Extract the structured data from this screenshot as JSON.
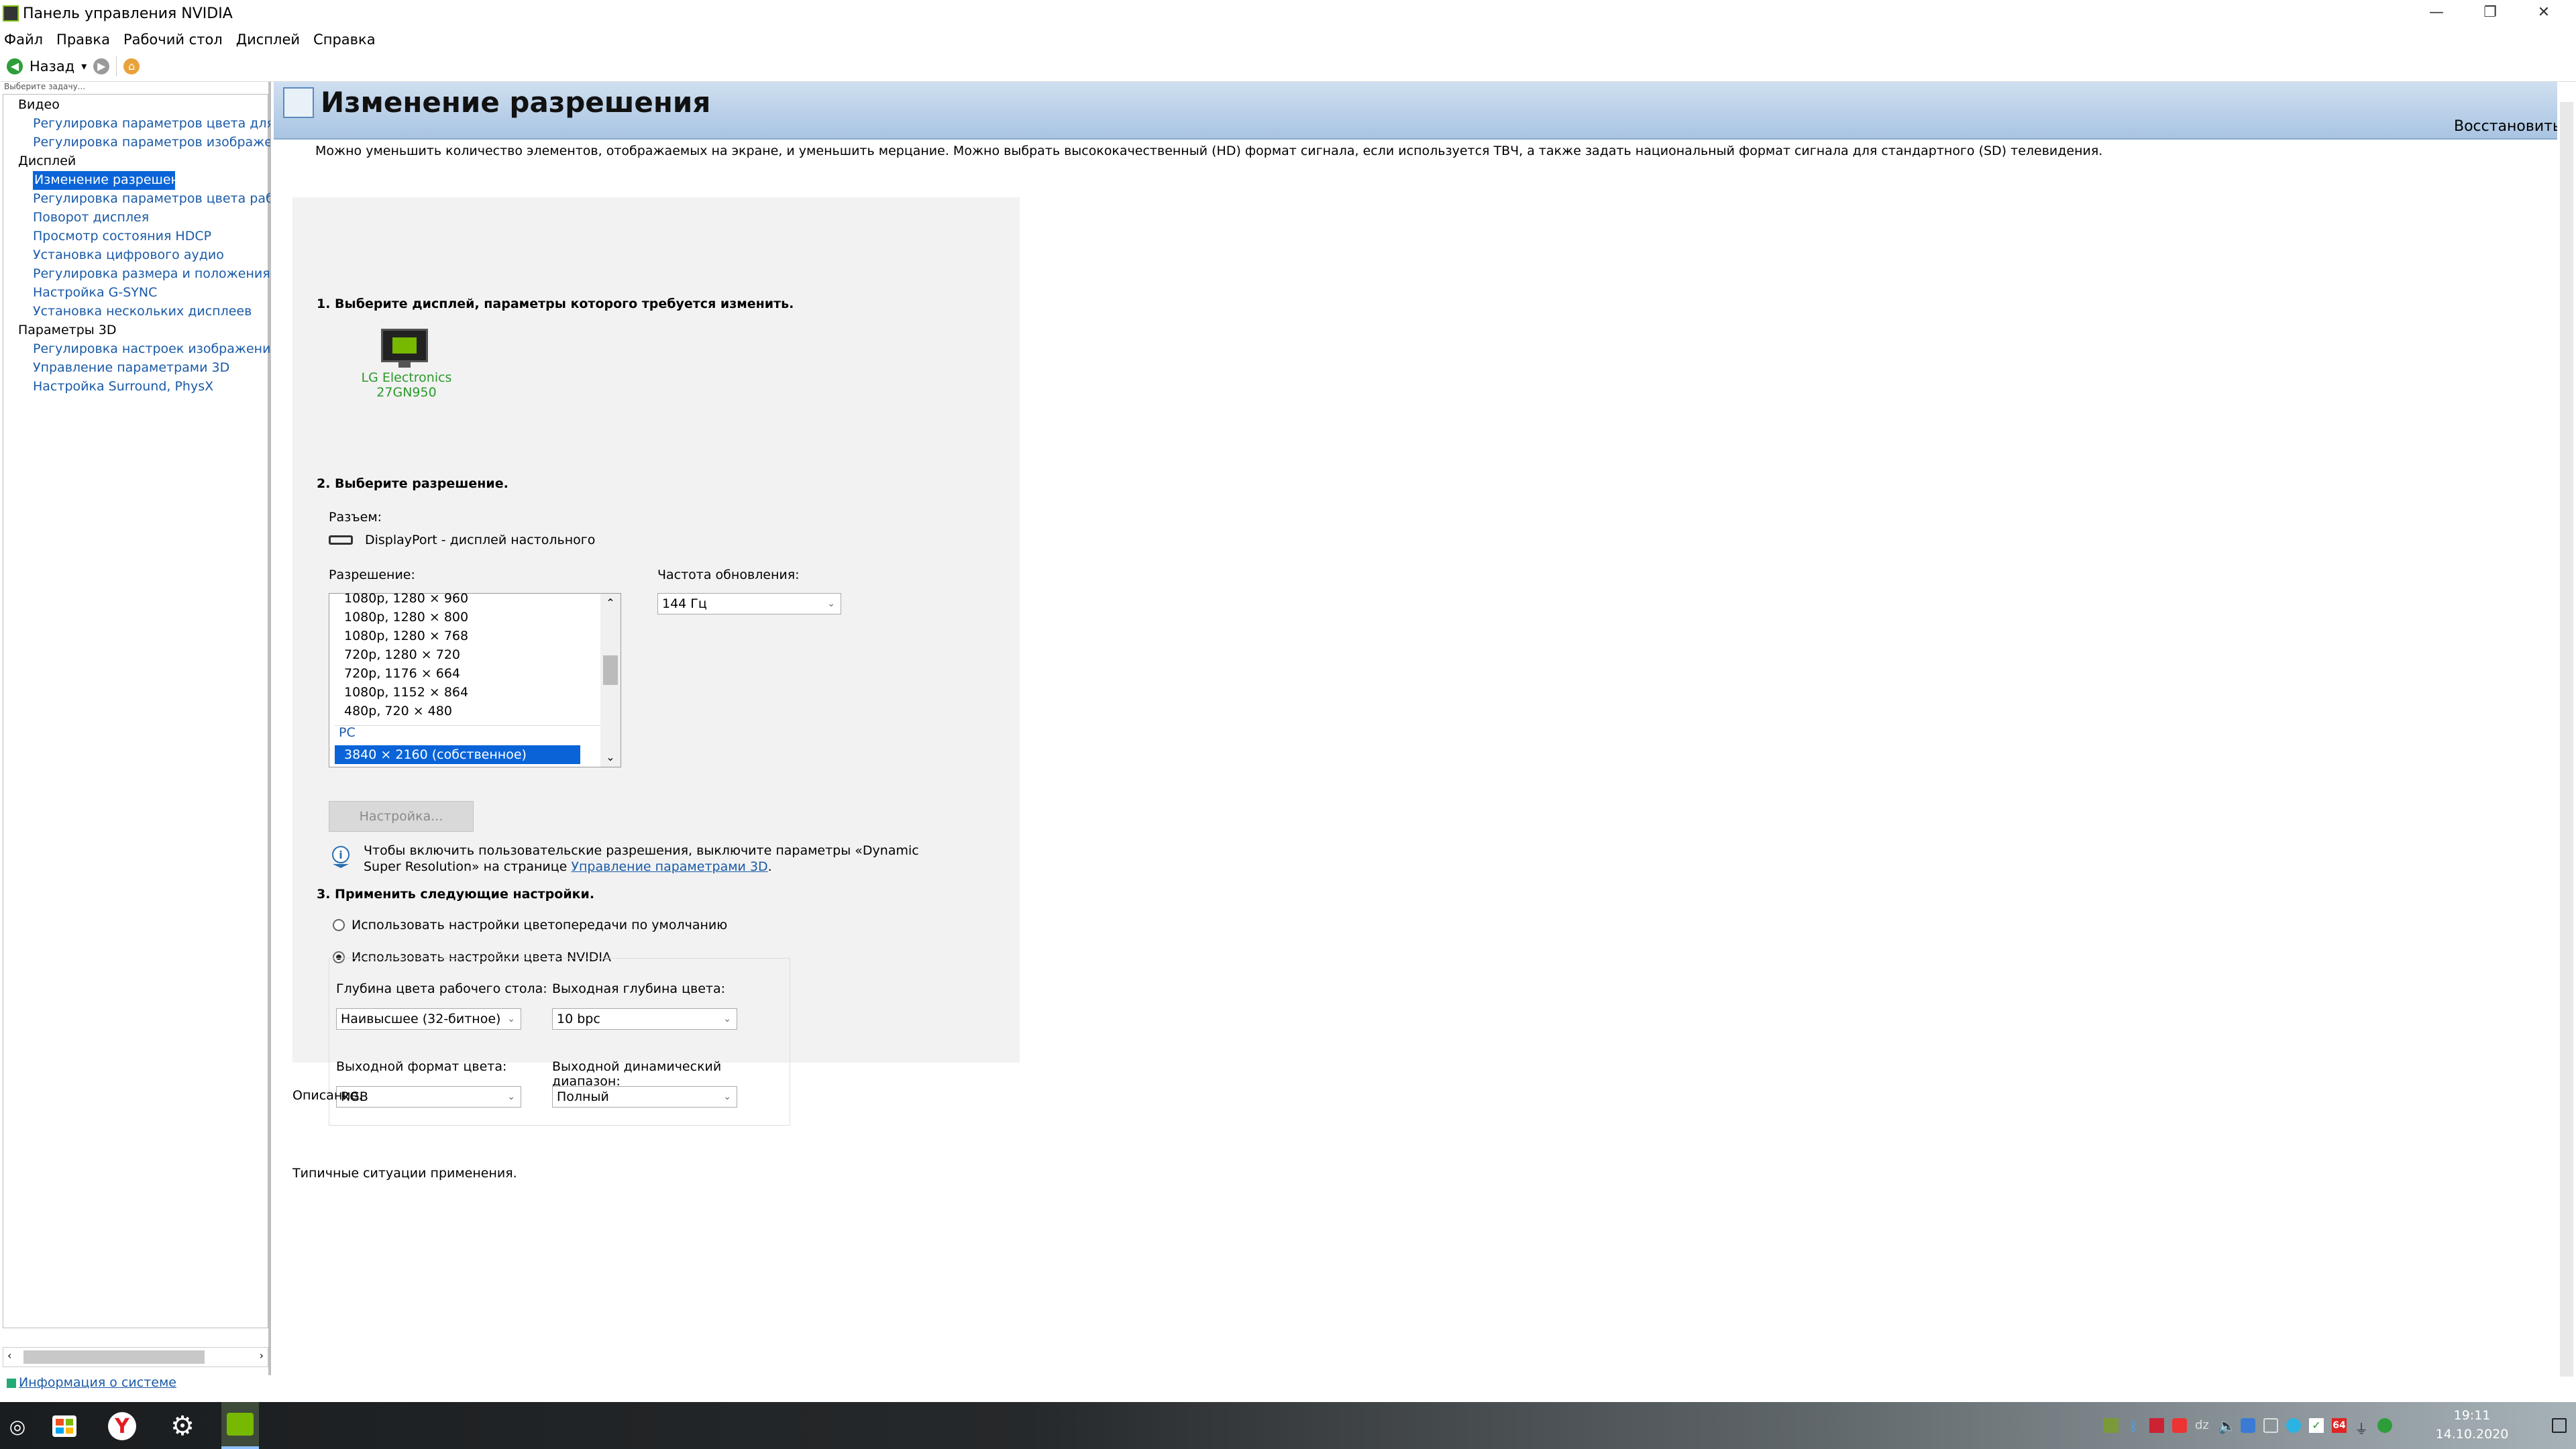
{
  "window": {
    "title": "Панель управления NVIDIA",
    "minimize": "—",
    "maximize": "❐",
    "close": "✕"
  },
  "menu": [
    "Файл",
    "Правка",
    "Рабочий стол",
    "Дисплей",
    "Справка"
  ],
  "toolbar": {
    "back_label": "Назад",
    "dropdown_glyph": "▾"
  },
  "sidebar": {
    "hint": "Выберите задачу...",
    "categories": [
      {
        "label": "Видео",
        "items": [
          "Регулировка параметров цвета для видео",
          "Регулировка параметров изображения для видео"
        ]
      },
      {
        "label": "Дисплей",
        "items": [
          "Изменение разрешения",
          "Регулировка параметров цвета рабочего стола",
          "Поворот дисплея",
          "Просмотр состояния HDCP",
          "Установка цифрового аудио",
          "Регулировка размера и положения рабочего стола",
          "Настройка G-SYNC",
          "Установка нескольких дисплеев"
        ]
      },
      {
        "label": "Параметры 3D",
        "items": [
          "Регулировка настроек изображения с просмотром",
          "Управление параметрами 3D",
          "Настройка Surround, PhysX"
        ]
      }
    ],
    "selected": "Изменение разрешения",
    "system_info": "Информация о системе"
  },
  "page": {
    "title": "Изменение разрешения",
    "restore": "Восстановить",
    "description": "Можно уменьшить количество элементов, отображаемых на экране, и уменьшить мерцание. Можно выбрать высококачественный (HD) формат сигнала, если используется ТВЧ, а также задать национальный формат сигнала для стандартного (SD) телевидения."
  },
  "step1": {
    "title": "1. Выберите дисплей, параметры которого требуется изменить.",
    "display_line1": "LG Electronics",
    "display_line2": "27GN950"
  },
  "step2": {
    "title": "2. Выберите разрешение.",
    "connector_label": "Разъем:",
    "connector_value": "DisplayPort - дисплей настольного",
    "resolution_label": "Разрешение:",
    "resolutions": [
      "1080p, 1280 × 960",
      "1080p, 1280 × 800",
      "1080p, 1280 × 768",
      "720p, 1280 × 720",
      "720p, 1176 × 664",
      "1080p, 1152 × 864",
      "480p, 720 × 480"
    ],
    "group_pc": "PC",
    "selected_resolution": "3840 × 2160 (собственное)",
    "refresh_label": "Частота обновления:",
    "refresh_value": "144 Гц",
    "setup_button": "Настройка...",
    "info_text_1": "Чтобы включить пользовательские разрешения, выключите параметры «Dynamic",
    "info_text_2": "Super Resolution» на странице",
    "info_link": "Управление параметрами 3D",
    "info_text_end": "."
  },
  "step3": {
    "title": "3. Применить следующие настройки.",
    "radio_default": "Использовать настройки цветопередачи по умолчанию",
    "radio_nvidia": "Использовать настройки цвета NVIDIA",
    "desktop_depth_label": "Глубина цвета рабочего стола:",
    "desktop_depth_value": "Наивысшее (32-битное)",
    "output_depth_label": "Выходная глубина цвета:",
    "output_depth_value": "10 bpc",
    "output_format_label": "Выходной формат цвета:",
    "output_format_value": "RGB",
    "dynamic_range_label": "Выходной динамический диапазон:",
    "dynamic_range_value": "Полный"
  },
  "footer": {
    "description_label": "Описание.",
    "typical_label": "Типичные ситуации применения."
  },
  "taskbar": {
    "time": "19:11",
    "date": "14.10.2020",
    "tray_badge": "64"
  },
  "colors": {
    "accent": "#0a64d8",
    "link": "#1a5aa6",
    "nvidia_green": "#76b900",
    "header_gradient_top": "#cfdff0"
  }
}
